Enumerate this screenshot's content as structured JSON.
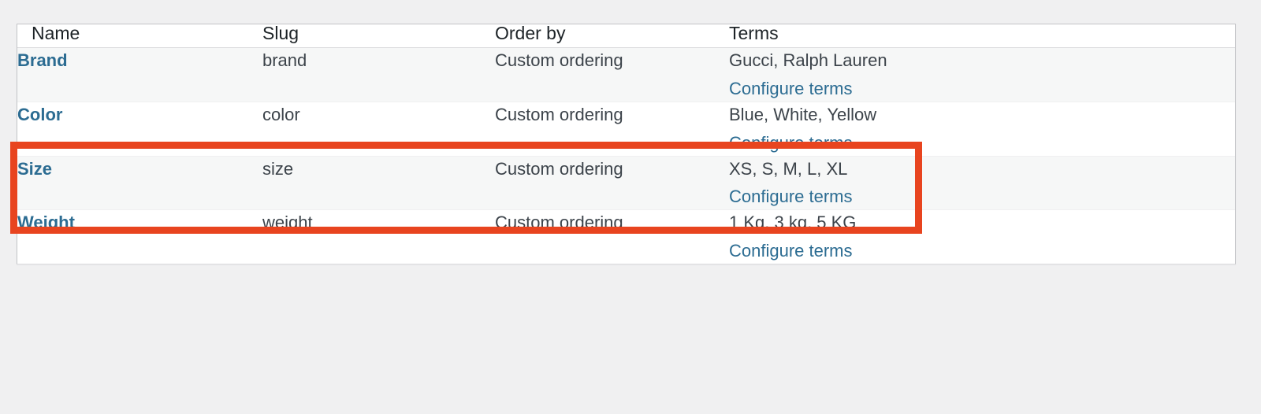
{
  "table": {
    "columns": [
      {
        "key": "name",
        "label": "Name"
      },
      {
        "key": "slug",
        "label": "Slug"
      },
      {
        "key": "order",
        "label": "Order by"
      },
      {
        "key": "terms",
        "label": "Terms"
      }
    ],
    "rows": [
      {
        "name": "Brand",
        "slug": "brand",
        "order_by": "Custom ordering",
        "terms": "Gucci, Ralph Lauren",
        "configure_label": "Configure terms"
      },
      {
        "name": "Color",
        "slug": "color",
        "order_by": "Custom ordering",
        "terms": "Blue, White, Yellow",
        "configure_label": "Configure terms"
      },
      {
        "name": "Size",
        "slug": "size",
        "order_by": "Custom ordering",
        "terms": "XS, S, M, L, XL",
        "configure_label": "Configure terms"
      },
      {
        "name": "Weight",
        "slug": "weight",
        "order_by": "Custom ordering",
        "terms": "1 Kg, 3 kg, 5 KG",
        "configure_label": "Configure terms"
      }
    ]
  },
  "annotation": {
    "highlight_color": "#e8441f",
    "target_row": "Color"
  },
  "colors": {
    "link": "#2c6c92",
    "text": "#3c434a",
    "heading": "#1d2327",
    "page_background": "#f0f0f1",
    "row_alt_background": "#f6f7f7",
    "row_background": "#ffffff",
    "border": "#c3c4c7"
  }
}
